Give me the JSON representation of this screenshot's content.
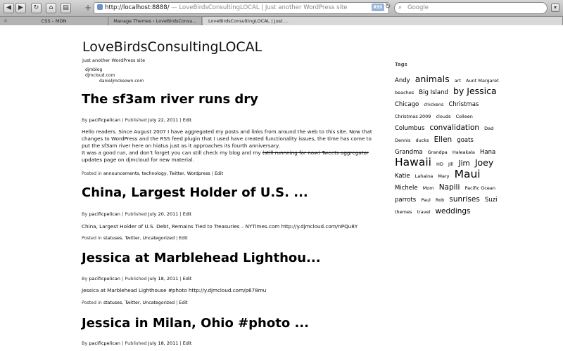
{
  "browser": {
    "url": "http://localhost:8888/",
    "page_title": "— LoveBirdsConsultingLOCAL | Just another WordPress site",
    "rss_label": "RSS",
    "search_placeholder": "Google",
    "tabs": [
      {
        "label": "CSS – MDN"
      },
      {
        "label": "Manage Themes ‹ LoveBirdsConsu..."
      },
      {
        "label": "LoveBirdsConsultingLOCAL | Just ..."
      }
    ]
  },
  "site": {
    "title": "LoveBirdsConsultingLOCAL",
    "tagline": "Just another WordPress site",
    "menu": [
      "djmblog",
      "djmcloud.com",
      "danieljmckeown.com"
    ]
  },
  "posts": [
    {
      "title": "The sf3am river runs dry",
      "author": "pacificpelican",
      "date": "July 22, 2011",
      "edit": "Edit",
      "body1": "Hello readers. Since August 2007 I have aggregated my posts and links from around the web to this site. Now that changes to WordPress and the RSS feed plugin that I used have created functionality issues, the time has come to put the sf3am river here on hiatus just as it approaches its fourth anniversary.",
      "body2_pre": "It was a good run, and don't forget you can still check my blog and my ",
      "body2_strike": "(still runnning for now) Tweets aggregator",
      "body2_post": " updates page on djmcloud for new material.",
      "categories": [
        "announcements",
        "technology",
        "Twitter",
        "Wordpress"
      ]
    },
    {
      "title": "China, Largest Holder of U.S. ...",
      "author": "pacificpelican",
      "date": "July 20, 2011",
      "edit": "Edit",
      "body": "China, Largest Holder of U.S. Debt, Remains Tied to Treasuries – NYTimes.com http://y.djmcloud.com/nPQu8Y",
      "categories": [
        "statuses",
        "Twitter",
        "Uncategorized"
      ]
    },
    {
      "title": "Jessica at Marblehead Lighthou...",
      "author": "pacificpelican",
      "date": "July 18, 2011",
      "edit": "Edit",
      "body": "Jessica at Marblehead Lighthouse #photo http://y.djmcloud.com/p678mu",
      "categories": [
        "statuses",
        "Twitter",
        "Uncategorized"
      ]
    },
    {
      "title": "Jessica in Milan, Ohio #photo ...",
      "author": "pacificpelican",
      "date": "July 18, 2011",
      "edit": "Edit"
    }
  ],
  "labels": {
    "by": "By",
    "published": "Published",
    "posted_in": "Posted in",
    "sep": "|"
  },
  "sidebar": {
    "heading": "Tags",
    "tags": [
      {
        "label": "Andy",
        "size": 2
      },
      {
        "label": "animals",
        "size": 4
      },
      {
        "label": "art",
        "size": 1
      },
      {
        "label": "Aunt Margaret",
        "size": 1
      },
      {
        "label": "beaches",
        "size": 1
      },
      {
        "label": "Big Island",
        "size": 2
      },
      {
        "label": "by Jessica",
        "size": 4
      },
      {
        "label": "Chicago",
        "size": 2
      },
      {
        "label": "chickens",
        "size": 1
      },
      {
        "label": "Christmas",
        "size": 2
      },
      {
        "label": "Christmas 2009",
        "size": 1
      },
      {
        "label": "clouds",
        "size": 1
      },
      {
        "label": "Colleen",
        "size": 1
      },
      {
        "label": "Columbus",
        "size": 2
      },
      {
        "label": "convalidation",
        "size": 3
      },
      {
        "label": "Dad",
        "size": 1
      },
      {
        "label": "Dennis",
        "size": 1
      },
      {
        "label": "ducks",
        "size": 1
      },
      {
        "label": "Ellen",
        "size": 3
      },
      {
        "label": "goats",
        "size": 2
      },
      {
        "label": "Grandma",
        "size": 2
      },
      {
        "label": "Grandpa",
        "size": 1
      },
      {
        "label": "Haleakala",
        "size": 1
      },
      {
        "label": "Hana",
        "size": 2
      },
      {
        "label": "Hawaii",
        "size": 5
      },
      {
        "label": "HD",
        "size": 1
      },
      {
        "label": "Jill",
        "size": 1
      },
      {
        "label": "Jim",
        "size": 3
      },
      {
        "label": "Joey",
        "size": 4
      },
      {
        "label": "Katie",
        "size": 2
      },
      {
        "label": "Lahaina",
        "size": 1
      },
      {
        "label": "Mary",
        "size": 1
      },
      {
        "label": "Maui",
        "size": 5
      },
      {
        "label": "Michele",
        "size": 2
      },
      {
        "label": "Mom",
        "size": 1
      },
      {
        "label": "Napili",
        "size": 3
      },
      {
        "label": "Pacific Ocean",
        "size": 1
      },
      {
        "label": "parrots",
        "size": 2
      },
      {
        "label": "Paul",
        "size": 1
      },
      {
        "label": "Rob",
        "size": 1
      },
      {
        "label": "sunrises",
        "size": 3
      },
      {
        "label": "Suzi",
        "size": 2
      },
      {
        "label": "themes",
        "size": 1
      },
      {
        "label": "travel",
        "size": 1
      },
      {
        "label": "weddings",
        "size": 3
      }
    ]
  }
}
